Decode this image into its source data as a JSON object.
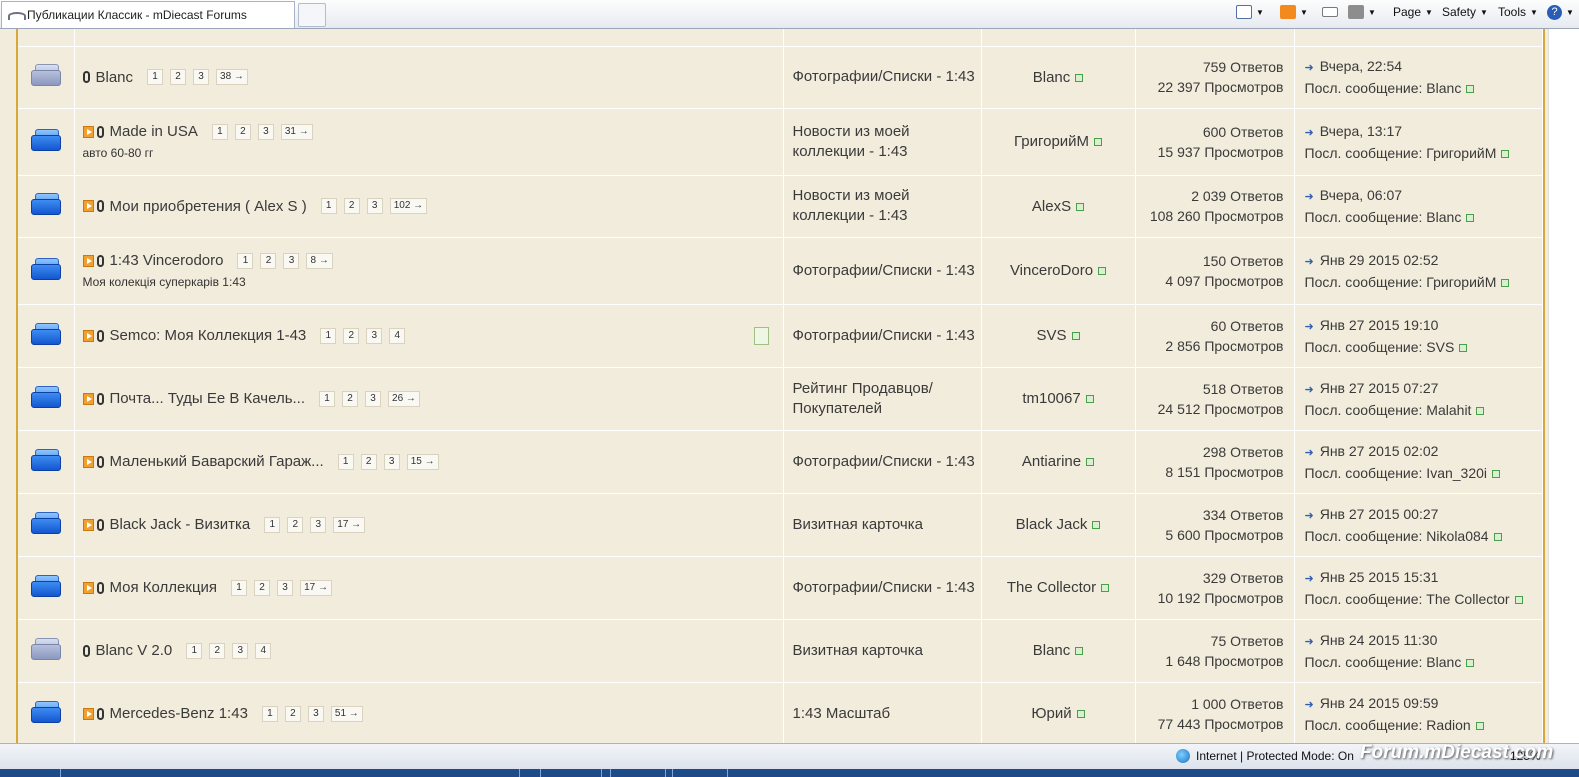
{
  "browser": {
    "tab_title": "Публикации Классик - mDiecast Forums",
    "page_label": "Page",
    "safety_label": "Safety",
    "tools_label": "Tools",
    "help_label": "?",
    "status_zone": "Internet | Protected Mode: On",
    "zoom": "125%",
    "watermark": "Forum.mDiecast.com"
  },
  "threads": [
    {
      "icon": "dim",
      "new": false,
      "title": "Blanc",
      "pages": [
        "1",
        "2",
        "3",
        "38 →"
      ],
      "subtitle": "",
      "forum": "Фотографии/Списки - 1:43",
      "author": "Blanc",
      "replies": "759 Ответов",
      "views": "22 397 Просмотров",
      "last_date": "Вчера, 22:54",
      "last_by": "Посл. сообщение: Blanc",
      "doc": false
    },
    {
      "icon": "blue",
      "new": true,
      "title": "Made in USA",
      "pages": [
        "1",
        "2",
        "3",
        "31 →"
      ],
      "subtitle": "авто 60-80 гг",
      "forum": "Новости из моей коллекции - 1:43",
      "author": "ГригорийМ",
      "replies": "600 Ответов",
      "views": "15 937 Просмотров",
      "last_date": "Вчера, 13:17",
      "last_by": "Посл. сообщение: ГригорийМ",
      "doc": false
    },
    {
      "icon": "blue",
      "new": true,
      "title": "Мои приобретения ( Alex S )",
      "pages": [
        "1",
        "2",
        "3",
        "102 →"
      ],
      "subtitle": "",
      "forum": "Новости из моей коллекции - 1:43",
      "author": "AlexS",
      "replies": "2 039 Ответов",
      "views": "108 260 Просмотров",
      "last_date": "Вчера, 06:07",
      "last_by": "Посл. сообщение: Blanc",
      "doc": false
    },
    {
      "icon": "blue",
      "new": true,
      "title": "1:43 Vincerodoro",
      "pages": [
        "1",
        "2",
        "3",
        "8 →"
      ],
      "subtitle": "Моя колекція суперкарів 1:43",
      "forum": "Фотографии/Списки - 1:43",
      "author": "VinceroDoro",
      "replies": "150 Ответов",
      "views": "4 097 Просмотров",
      "last_date": "Янв 29 2015 02:52",
      "last_by": "Посл. сообщение: ГригорийМ",
      "doc": false
    },
    {
      "icon": "blue",
      "new": true,
      "title": "Semco: Моя Коллекция 1-43",
      "pages": [
        "1",
        "2",
        "3",
        "4"
      ],
      "subtitle": "",
      "forum": "Фотографии/Списки - 1:43",
      "author": "SVS",
      "replies": "60 Ответов",
      "views": "2 856 Просмотров",
      "last_date": "Янв 27 2015 19:10",
      "last_by": "Посл. сообщение: SVS",
      "doc": true
    },
    {
      "icon": "blue",
      "new": true,
      "title": "Почта... Туды Ее В Качель...",
      "pages": [
        "1",
        "2",
        "3",
        "26 →"
      ],
      "subtitle": "",
      "forum": "Рейтинг Продавцов/Покупателей",
      "author": "tm10067",
      "replies": "518 Ответов",
      "views": "24 512 Просмотров",
      "last_date": "Янв 27 2015 07:27",
      "last_by": "Посл. сообщение: Malahit",
      "doc": false
    },
    {
      "icon": "blue",
      "new": true,
      "title": "Маленький Баварский Гараж...",
      "pages": [
        "1",
        "2",
        "3",
        "15 →"
      ],
      "subtitle": "",
      "forum": "Фотографии/Списки - 1:43",
      "author": "Antiarine",
      "replies": "298 Ответов",
      "views": "8 151 Просмотров",
      "last_date": "Янв 27 2015 02:02",
      "last_by": "Посл. сообщение: Ivan_320i",
      "doc": false
    },
    {
      "icon": "blue",
      "new": true,
      "title": "Black Jack - Визитка",
      "pages": [
        "1",
        "2",
        "3",
        "17 →"
      ],
      "subtitle": "",
      "forum": "Визитная карточка",
      "author": "Black Jack",
      "replies": "334 Ответов",
      "views": "5 600 Просмотров",
      "last_date": "Янв 27 2015 00:27",
      "last_by": "Посл. сообщение: Nikola084",
      "doc": false
    },
    {
      "icon": "blue",
      "new": true,
      "title": "Моя Коллекция",
      "pages": [
        "1",
        "2",
        "3",
        "17 →"
      ],
      "subtitle": "",
      "forum": "Фотографии/Списки - 1:43",
      "author": "The Collector",
      "replies": "329 Ответов",
      "views": "10 192 Просмотров",
      "last_date": "Янв 25 2015 15:31",
      "last_by": "Посл. сообщение: The Collector",
      "doc": false
    },
    {
      "icon": "dim",
      "new": false,
      "title": "Blanc V 2.0",
      "pages": [
        "1",
        "2",
        "3",
        "4"
      ],
      "subtitle": "",
      "forum": "Визитная карточка",
      "author": "Blanc",
      "replies": "75 Ответов",
      "views": "1 648 Просмотров",
      "last_date": "Янв 24 2015 11:30",
      "last_by": "Посл. сообщение: Blanc",
      "doc": false
    },
    {
      "icon": "blue",
      "new": true,
      "title": "Mercedes-Benz 1:43",
      "pages": [
        "1",
        "2",
        "3",
        "51 →"
      ],
      "subtitle": "",
      "forum": "1:43 Масштаб",
      "author": "Юрий",
      "replies": "1 000 Ответов",
      "views": "77 443 Просмотров",
      "last_date": "Янв 24 2015 09:59",
      "last_by": "Посл. сообщение: Radion",
      "doc": false
    }
  ]
}
